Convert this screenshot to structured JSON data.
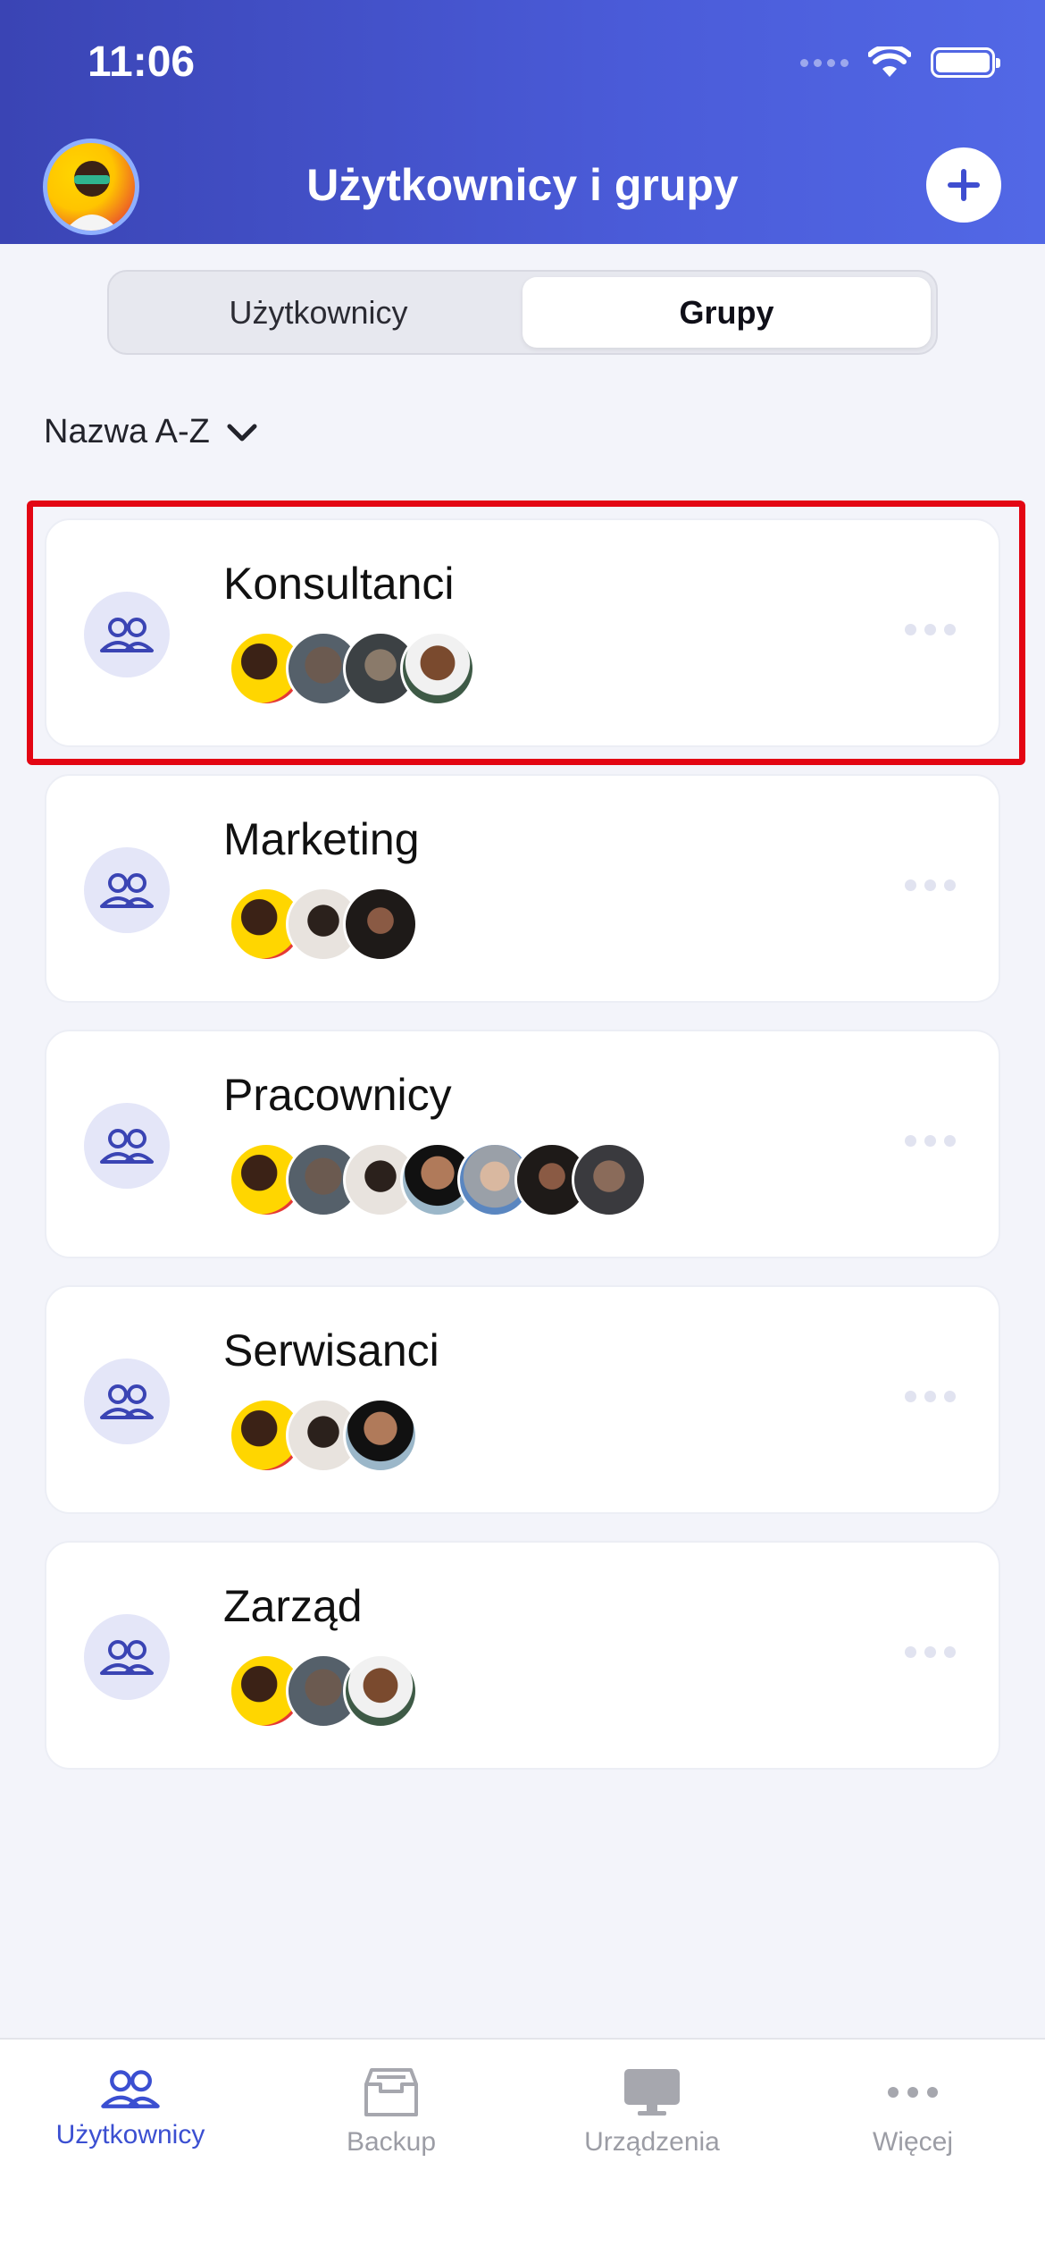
{
  "status_bar": {
    "time": "11:06"
  },
  "header": {
    "title": "Użytkownicy i grupy"
  },
  "segmented": {
    "users": "Użytkownicy",
    "groups": "Grupy",
    "selected": "Grupy"
  },
  "sort": {
    "label": "Nazwa A-Z"
  },
  "groups": [
    {
      "name": "Konsultanci",
      "member_count": 4,
      "highlighted": true
    },
    {
      "name": "Marketing",
      "member_count": 3
    },
    {
      "name": "Pracownicy",
      "member_count": 7
    },
    {
      "name": "Serwisanci",
      "member_count": 3
    },
    {
      "name": "Zarząd",
      "member_count": 3
    }
  ],
  "tabbar": {
    "users": "Użytkownicy",
    "backup": "Backup",
    "devices": "Urządzenia",
    "more": "Więcej",
    "active": "Użytkownicy"
  },
  "colors": {
    "accent": "#3b4fd1",
    "highlight": "#e30613",
    "header_start": "#3a44b4",
    "header_end": "#5268e6"
  }
}
